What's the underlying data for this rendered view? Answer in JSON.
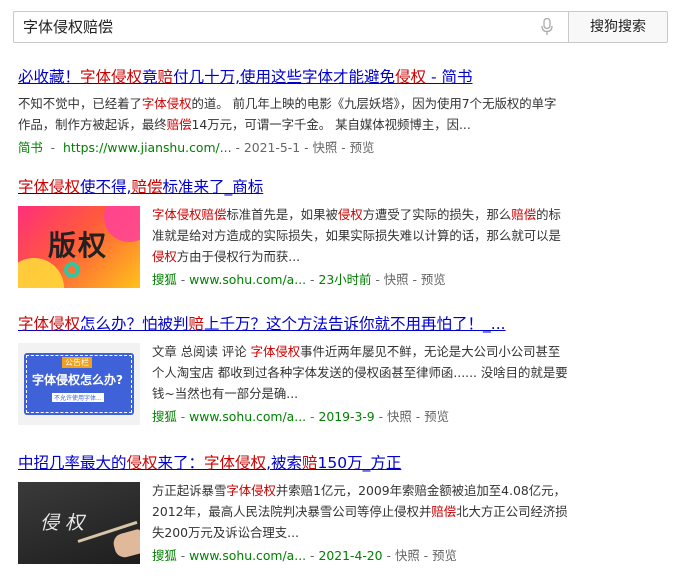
{
  "search": {
    "query": "字体侵权赔偿",
    "button_label": "搜狗搜索"
  },
  "results": [
    {
      "title_parts": [
        {
          "t": "必收藏！",
          "hl": false
        },
        {
          "t": "字体侵权",
          "hl": true
        },
        {
          "t": "竟",
          "hl": false
        },
        {
          "t": "赔",
          "hl": true
        },
        {
          "t": "付几十万,使用这些字体才能避免",
          "hl": false
        },
        {
          "t": "侵权",
          "hl": true
        },
        {
          "t": " - 简书",
          "hl": false
        }
      ],
      "snippet_parts": [
        {
          "t": "不知不觉中，已经着了",
          "hl": false
        },
        {
          "t": "字体侵权",
          "hl": true
        },
        {
          "t": "的道。 前几年上映的电影《九层妖塔》，因为使用7个无版权的单字作品，制作方被起诉，最终",
          "hl": false
        },
        {
          "t": "赔偿",
          "hl": true
        },
        {
          "t": "14万元，可谓一字千金。 某自媒体视频博主，因...",
          "hl": false
        }
      ],
      "source": "简书",
      "url": "https://www.jianshu.com/...",
      "date": "2021-5-1",
      "snapshot": "快照",
      "preview": "预览"
    },
    {
      "title_parts": [
        {
          "t": "字体侵权",
          "hl": true
        },
        {
          "t": "使不得,",
          "hl": false
        },
        {
          "t": "赔偿",
          "hl": true
        },
        {
          "t": "标准来了_商标",
          "hl": false
        }
      ],
      "snippet_parts": [
        {
          "t": "字体侵权赔偿",
          "hl": true
        },
        {
          "t": "标准首先是，如果被",
          "hl": false
        },
        {
          "t": "侵权",
          "hl": true
        },
        {
          "t": "方遭受了实际的损失，那么",
          "hl": false
        },
        {
          "t": "赔偿",
          "hl": true
        },
        {
          "t": "的标准就是给对方造成的实际损失，如果实际损失难以计算的话，那么就可以是",
          "hl": false
        },
        {
          "t": "侵权",
          "hl": true
        },
        {
          "t": "方由于侵权行为而获...",
          "hl": false
        }
      ],
      "source": "搜狐",
      "url": "www.sohu.com/a...",
      "date": "23小时前",
      "snapshot": "快照",
      "preview": "预览",
      "thumb_text": "版权"
    },
    {
      "title_parts": [
        {
          "t": "字体侵权",
          "hl": true
        },
        {
          "t": "怎么办？怕被判",
          "hl": false
        },
        {
          "t": "赔",
          "hl": true
        },
        {
          "t": "上千万？这个方法告诉你就不用再怕了！_...",
          "hl": false
        }
      ],
      "snippet_parts": [
        {
          "t": "文章 总阅读 评论 ",
          "hl": false
        },
        {
          "t": "字体侵权",
          "hl": true
        },
        {
          "t": "事件近两年屡见不鲜，无论是大公司小公司甚至个人淘宝店 都收到过各种字体发送的侵权函甚至律师函...... 没啥目的就是要钱~当然也有一部分是确...",
          "hl": false
        }
      ],
      "source": "搜狐",
      "url": "www.sohu.com/a...",
      "date": "2019-3-9",
      "snapshot": "快照",
      "preview": "预览",
      "thumb_tag": "公告栏",
      "thumb_text": "字体侵权怎么办?",
      "thumb_sub": "不允许使用字体..."
    },
    {
      "title_parts": [
        {
          "t": "中招几率最大的",
          "hl": false
        },
        {
          "t": "侵权",
          "hl": true
        },
        {
          "t": "来了：",
          "hl": false
        },
        {
          "t": "字体侵权",
          "hl": true
        },
        {
          "t": ",被索",
          "hl": false
        },
        {
          "t": "赔",
          "hl": true
        },
        {
          "t": "150万_方正",
          "hl": false
        }
      ],
      "snippet_parts": [
        {
          "t": "方正起诉暴雪",
          "hl": false
        },
        {
          "t": "字体侵权",
          "hl": true
        },
        {
          "t": "并索赔1亿元，2009年索赔金额被追加至4.08亿元，2012年，最高人民法院判决暴雪公司等停止侵权并",
          "hl": false
        },
        {
          "t": "赔偿",
          "hl": true
        },
        {
          "t": "北大方正公司经济损失200万元及诉讼合理支...",
          "hl": false
        }
      ],
      "source": "搜狐",
      "url": "www.sohu.com/a...",
      "date": "2021-4-20",
      "snapshot": "快照",
      "preview": "预览",
      "thumb_text": "侵权"
    }
  ]
}
